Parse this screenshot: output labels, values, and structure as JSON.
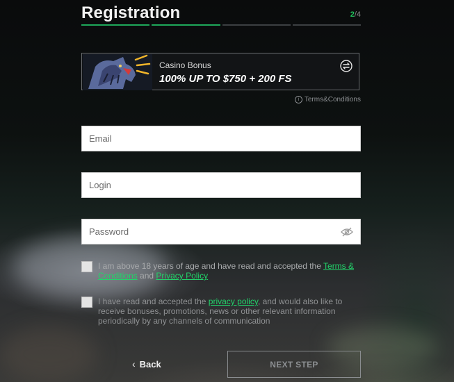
{
  "header": {
    "title": "Registration",
    "step_current": "2",
    "step_total": "/4"
  },
  "progress": {
    "completed_steps": 2,
    "total_steps": 4
  },
  "bonus": {
    "label": "Casino Bonus",
    "amount": "100% UP TO $750 + 200 FS",
    "terms_link": "Terms&Conditions"
  },
  "form": {
    "email_placeholder": "Email",
    "login_placeholder": "Login",
    "password_placeholder": "Password"
  },
  "consent_age": {
    "text_before": "I am above 18 years of age and have read and accepted the ",
    "terms_link": "Terms & Conditions",
    "text_mid": " and ",
    "privacy_link": "Privacy Policy"
  },
  "consent_marketing": {
    "text_before": "I have read and accepted the ",
    "privacy_link": "privacy policy",
    "text_after": ", and would also like to receive bonuses, promotions, news or other relevant information periodically by any channels of communication"
  },
  "footer": {
    "back_label": "Back",
    "next_label": "NEXT STEP"
  },
  "colors": {
    "accent": "#22c55e",
    "progress_done": "#1ea85a",
    "link": "#22d36a"
  }
}
